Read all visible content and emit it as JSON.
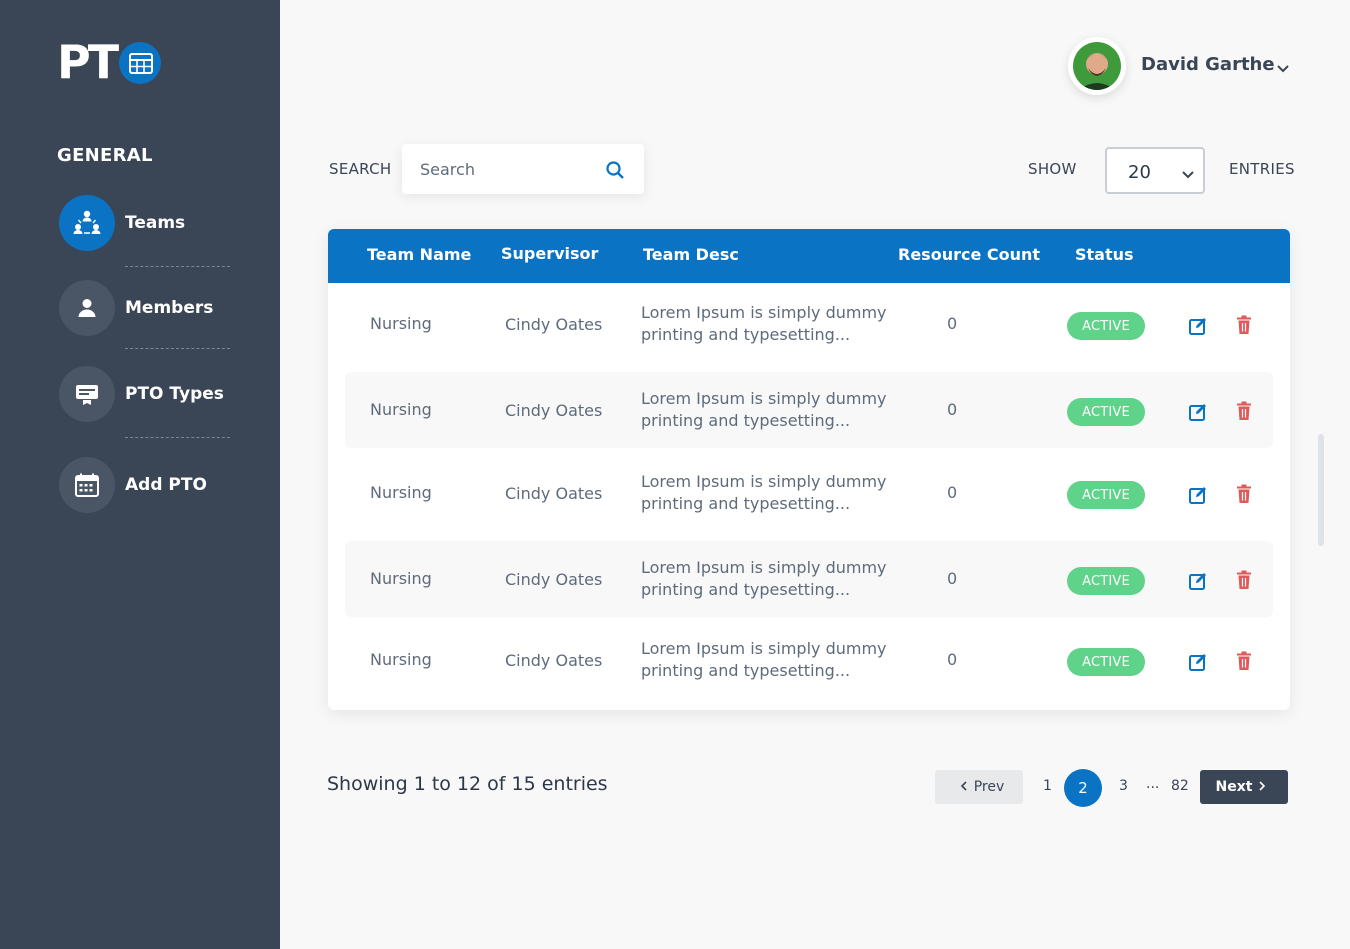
{
  "brand": {
    "logo_text": "PT"
  },
  "colors": {
    "primary": "#0b73c3",
    "sidebar": "#3a4556",
    "status_active": "#5fd38a",
    "delete": "#e05a5a"
  },
  "sidebar": {
    "heading": "GENERAL",
    "items": [
      {
        "label": "Teams",
        "icon": "teams-icon",
        "active": true
      },
      {
        "label": "Members",
        "icon": "person-icon",
        "active": false
      },
      {
        "label": "PTO Types",
        "icon": "card-icon",
        "active": false
      },
      {
        "label": "Add PTO",
        "icon": "calendar-icon",
        "active": false
      }
    ]
  },
  "header": {
    "user_name": "David Garthe"
  },
  "toolbar": {
    "search_label": "SEARCH",
    "search_placeholder": "Search",
    "show_label": "SHOW",
    "entries_value": "20",
    "entries_label": "ENTRIES"
  },
  "table": {
    "columns": [
      "Team Name",
      "Supervisor",
      "Team Desc",
      "Resource Count",
      "Status"
    ],
    "rows": [
      {
        "team": "Nursing",
        "supervisor": "Cindy Oates",
        "desc": "Lorem Ipsum is simply dummy printing and typesetting...",
        "count": "0",
        "status": "ACTIVE"
      },
      {
        "team": "Nursing",
        "supervisor": "Cindy Oates",
        "desc": "Lorem Ipsum is simply dummy printing and typesetting...",
        "count": "0",
        "status": "ACTIVE"
      },
      {
        "team": "Nursing",
        "supervisor": "Cindy Oates",
        "desc": "Lorem Ipsum is simply dummy printing and typesetting...",
        "count": "0",
        "status": "ACTIVE"
      },
      {
        "team": "Nursing",
        "supervisor": "Cindy Oates",
        "desc": "Lorem Ipsum is simply dummy printing and typesetting...",
        "count": "0",
        "status": "ACTIVE"
      },
      {
        "team": "Nursing",
        "supervisor": "Cindy Oates",
        "desc": "Lorem Ipsum is simply dummy printing and typesetting...",
        "count": "0",
        "status": "ACTIVE"
      }
    ]
  },
  "footer": {
    "showing_text": "Showing 1 to 12 of 15 entries",
    "prev_label": "Prev",
    "next_label": "Next",
    "pages": [
      "1",
      "2",
      "3",
      "...",
      "82"
    ],
    "current_page": "2"
  }
}
